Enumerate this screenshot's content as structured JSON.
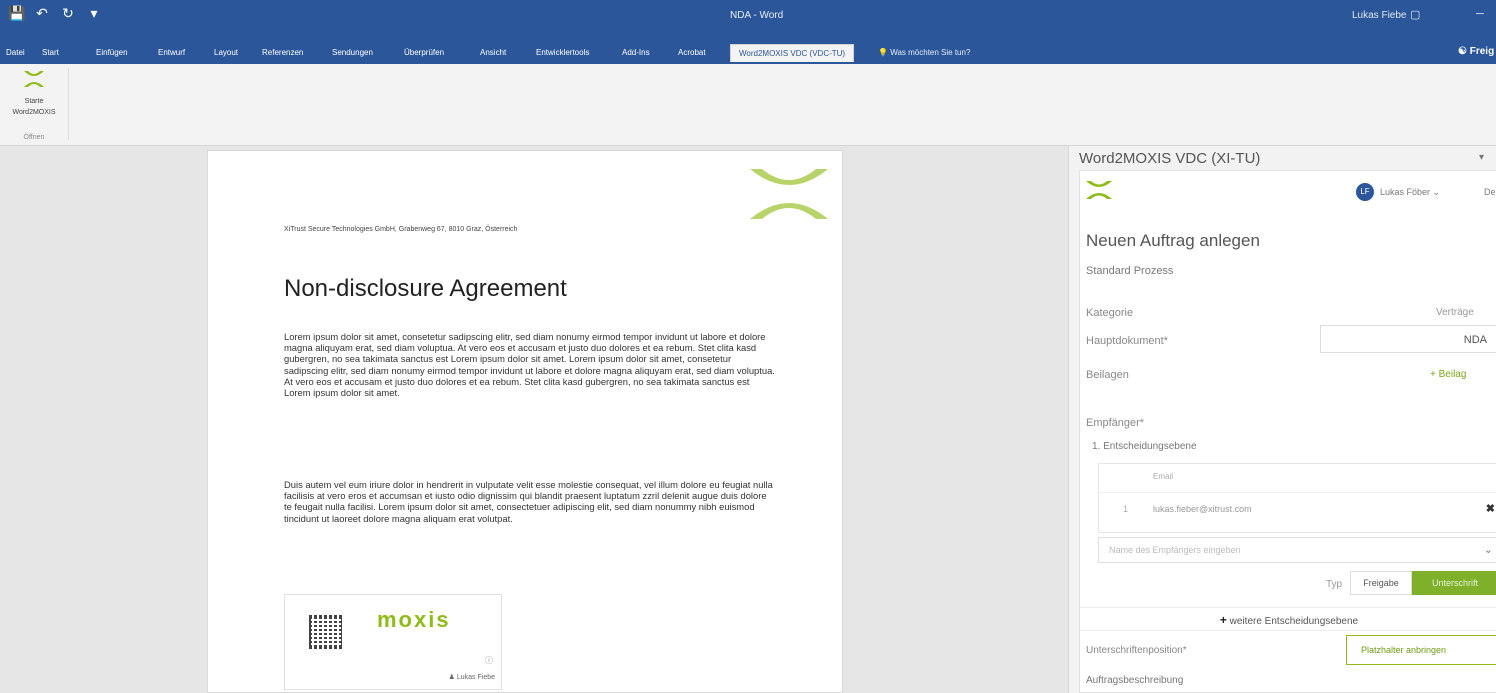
{
  "titlebar": {
    "doc_title": "NDA - Word",
    "user": "Lukas Fiebe",
    "icons": [
      "save-icon",
      "undo-icon",
      "redo-icon",
      "customize-qat-icon"
    ]
  },
  "ribbon": {
    "tabs": [
      "Datei",
      "Start",
      "Einfügen",
      "Entwurf",
      "Layout",
      "Referenzen",
      "Sendungen",
      "Überprüfen",
      "Ansicht",
      "Entwicklertools",
      "Add-Ins",
      "Acrobat"
    ],
    "active_tab": "Word2MOXIS VDC (VDC-TU)",
    "tell_me": "Was möchten Sie tun?",
    "share": "Freig",
    "button_label_1": "Starte",
    "button_label_2": "Word2MOXIS",
    "group_label": "Öffnen"
  },
  "document": {
    "address": "XiTrust Secure Technologies GmbH, Grabenweg 67, 8010 Graz, Österreich",
    "title": "Non-disclosure Agreement",
    "paragraph1": "Lorem ipsum dolor sit amet, consetetur sadipscing elitr, sed diam nonumy eirmod tempor invidunt ut labore et dolore magna aliquyam erat, sed diam voluptua. At vero eos et accusam et justo duo dolores et ea rebum. Stet clita kasd gubergren, no sea takimata sanctus est Lorem ipsum dolor sit amet. Lorem ipsum dolor sit amet, consetetur sadipscing elitr, sed diam nonumy eirmod tempor invidunt ut labore et dolore magna aliquyam erat, sed diam voluptua. At vero eos et accusam et justo duo dolores et ea rebum. Stet clita kasd gubergren, no sea takimata sanctus est Lorem ipsum dolor sit amet.",
    "paragraph2": "Duis autem vel eum iriure dolor in hendrerit in vulputate velit esse molestie consequat, vel illum dolore eu feugiat nulla facilisis at vero eros et accumsan et iusto odio dignissim qui blandit praesent luptatum zzril delenit augue duis dolore te feugait nulla facilisi. Lorem ipsum dolor sit amet, consectetuer adipiscing elit, sed diam nonummy nibh euismod tincidunt ut laoreet dolore magna aliquam erat volutpat.",
    "signature_logo": "moxis",
    "signature_user": "Lukas Fiebe"
  },
  "pane": {
    "title": "Word2MOXIS VDC (XI-TU)",
    "avatar": "LF",
    "user": "Lukas Föber ⌄",
    "user_extra": "De",
    "heading": "Neuen Auftrag anlegen",
    "process": "Standard Prozess",
    "category_label": "Kategorie",
    "category_value": "Verträge",
    "main_doc_label": "Hauptdokument*",
    "main_doc_value": "NDA",
    "attachments_label": "Beilagen",
    "attachments_add": "+ Beilag",
    "recipients_label": "Empfänger*",
    "level1": "1. Entscheidungsebene",
    "table_header": "Email",
    "row_num": "1",
    "row_email": "lukas.fieber@xitrust.com",
    "recipient_placeholder": "Name des Empfängers eingeben",
    "type_label": "Typ",
    "btn_approve": "Freigabe",
    "btn_sign": "Unterschrift",
    "more_level": "weitere Entscheidungsebene",
    "sig_pos_label": "Unterschriftenposition*",
    "placeholder_btn": "Platzhalter anbringen",
    "desc_label": "Auftragsbeschreibung"
  },
  "colors": {
    "word_blue": "#2b579a",
    "moxis_green": "#8fbc1a"
  }
}
